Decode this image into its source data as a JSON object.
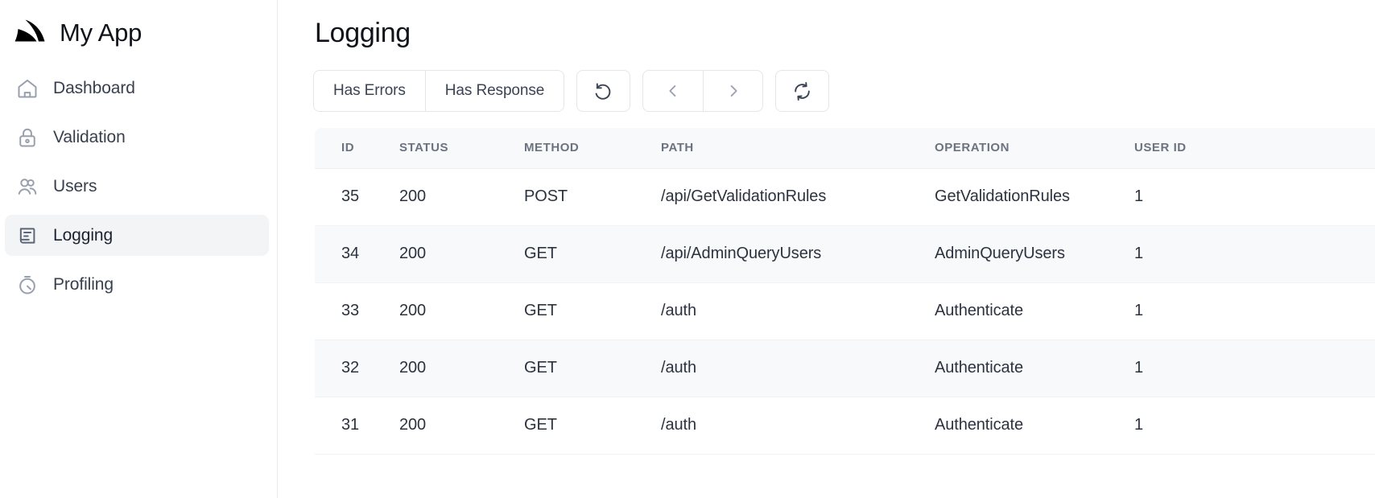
{
  "brand": {
    "name": "My App",
    "logo_icon": "shark-fin-logo-icon"
  },
  "sidebar": {
    "items": [
      {
        "label": "Dashboard",
        "icon": "home-icon",
        "active": false
      },
      {
        "label": "Validation",
        "icon": "lock-icon",
        "active": false
      },
      {
        "label": "Users",
        "icon": "users-icon",
        "active": false
      },
      {
        "label": "Logging",
        "icon": "log-document-icon",
        "active": true
      },
      {
        "label": "Profiling",
        "icon": "timer-icon",
        "active": false
      }
    ]
  },
  "main": {
    "title": "Logging",
    "toolbar": {
      "has_errors_label": "Has Errors",
      "has_response_label": "Has Response",
      "reset_icon": "undo-arrow-icon",
      "prev_icon": "chevron-left-icon",
      "next_icon": "chevron-right-icon",
      "refresh_icon": "refresh-circle-icon"
    },
    "table": {
      "columns": [
        "ID",
        "STATUS",
        "METHOD",
        "PATH",
        "OPERATION",
        "USER ID"
      ],
      "rows": [
        {
          "id": "35",
          "status": "200",
          "method": "POST",
          "path": "/api/GetValidationRules",
          "operation": "GetValidationRules",
          "user_id": "1"
        },
        {
          "id": "34",
          "status": "200",
          "method": "GET",
          "path": "/api/AdminQueryUsers",
          "operation": "AdminQueryUsers",
          "user_id": "1"
        },
        {
          "id": "33",
          "status": "200",
          "method": "GET",
          "path": "/auth",
          "operation": "Authenticate",
          "user_id": "1"
        },
        {
          "id": "32",
          "status": "200",
          "method": "GET",
          "path": "/auth",
          "operation": "Authenticate",
          "user_id": "1"
        },
        {
          "id": "31",
          "status": "200",
          "method": "GET",
          "path": "/auth",
          "operation": "Authenticate",
          "user_id": "1"
        }
      ]
    }
  },
  "colors": {
    "active_nav_bg": "#f3f4f6",
    "table_header_bg": "#f8f9fb",
    "row_stripe_bg": "#f8f9fb",
    "border": "#e8eaed",
    "text_primary": "#11131a",
    "text_muted": "#6b7280"
  }
}
